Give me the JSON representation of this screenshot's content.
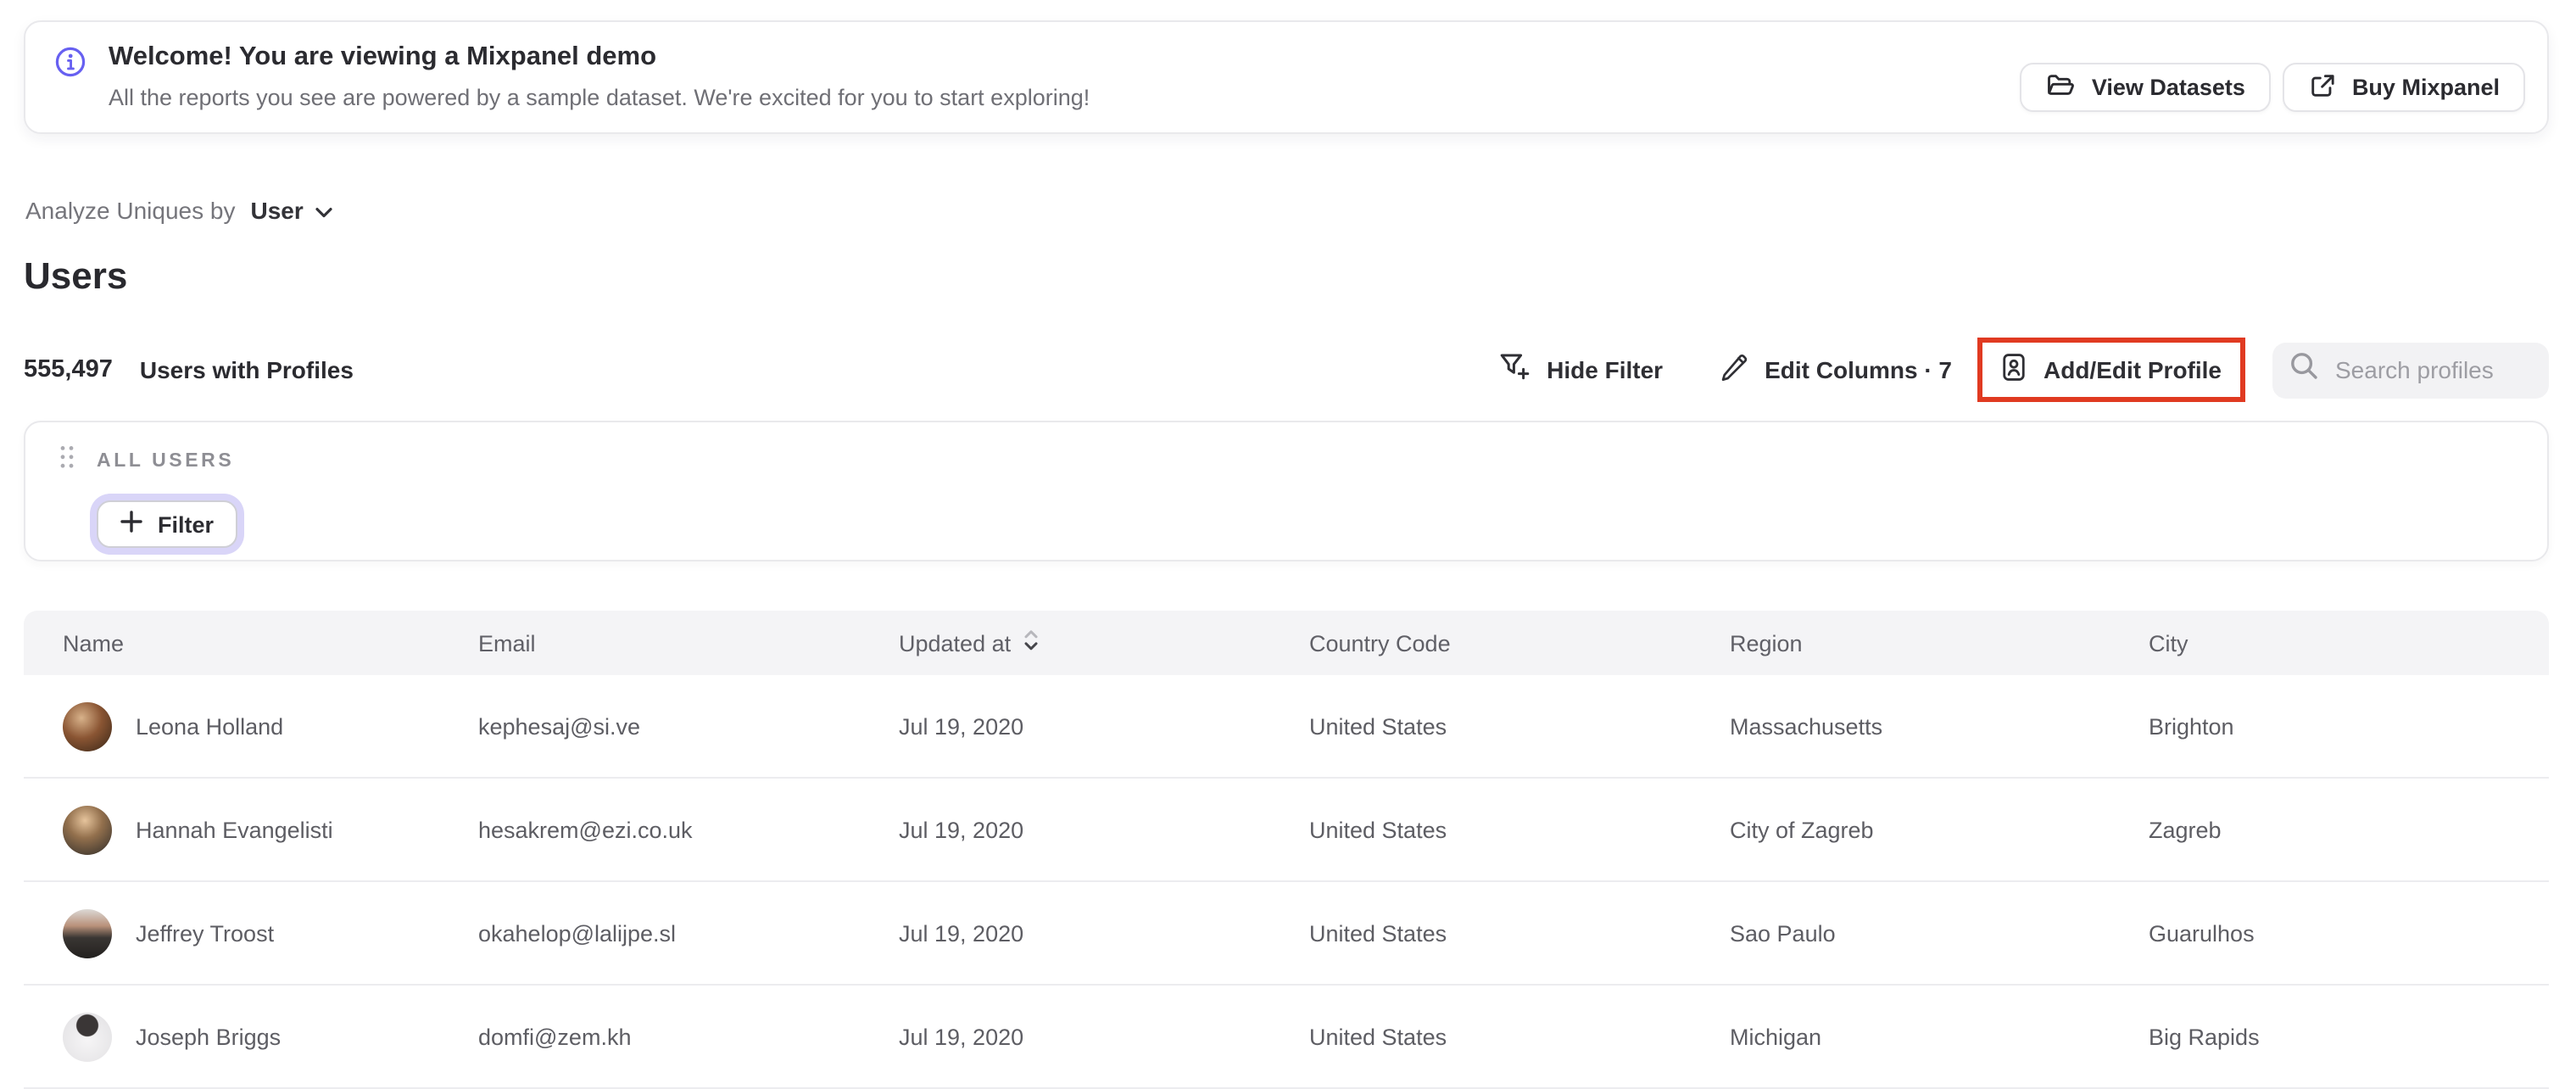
{
  "colors": {
    "accent_purple": "#6760f1",
    "annotation_red": "#e03a21",
    "filter_focus_ring": "#d9d5f8",
    "table_header_bg": "#f4f4f6"
  },
  "banner": {
    "icon": "info-icon",
    "title": "Welcome! You are viewing a Mixpanel demo",
    "subtitle": "All the reports you see are powered by a sample dataset. We're excited for you to start exploring!",
    "buttons": [
      {
        "label": "View Datasets",
        "icon": "folder-icon"
      },
      {
        "label": "Buy Mixpanel",
        "icon": "external-link-icon"
      }
    ]
  },
  "analyze": {
    "prefix": "Analyze Uniques by",
    "selected": "User",
    "icon": "chevron-down-icon"
  },
  "page_title": "Users",
  "summary": {
    "count": "555,497",
    "label": "Users with Profiles"
  },
  "toolbar": {
    "items": [
      {
        "label": "Hide Filter",
        "icon": "funnel-plus-icon"
      },
      {
        "label": "Edit Columns · 7",
        "icon": "pencil-icon"
      },
      {
        "label": "Add/Edit Profile",
        "icon": "profile-badge-icon",
        "annotated": true
      }
    ],
    "search": {
      "placeholder": "Search profiles",
      "icon": "search-icon"
    }
  },
  "filter_panel": {
    "drag_icon": "drag-handle-icon",
    "group_label": "ALL USERS",
    "filter_button": {
      "label": "Filter",
      "icon": "plus-icon"
    }
  },
  "table": {
    "columns": [
      "Name",
      "Email",
      "Updated at",
      "Country Code",
      "Region",
      "City"
    ],
    "sorted_column": "Updated at",
    "sort_icon": "sort-updown-icon",
    "rows": [
      {
        "name": "Leona Holland",
        "email": "kephesaj@si.ve",
        "updated_at": "Jul 19, 2020",
        "country_code": "United States",
        "region": "Massachusetts",
        "city": "Brighton"
      },
      {
        "name": "Hannah Evangelisti",
        "email": "hesakrem@ezi.co.uk",
        "updated_at": "Jul 19, 2020",
        "country_code": "United States",
        "region": "City of Zagreb",
        "city": "Zagreb"
      },
      {
        "name": "Jeffrey Troost",
        "email": "okahelop@lalijpe.sl",
        "updated_at": "Jul 19, 2020",
        "country_code": "United States",
        "region": "Sao Paulo",
        "city": "Guarulhos"
      },
      {
        "name": "Joseph Briggs",
        "email": "domfi@zem.kh",
        "updated_at": "Jul 19, 2020",
        "country_code": "United States",
        "region": "Michigan",
        "city": "Big Rapids"
      }
    ]
  }
}
